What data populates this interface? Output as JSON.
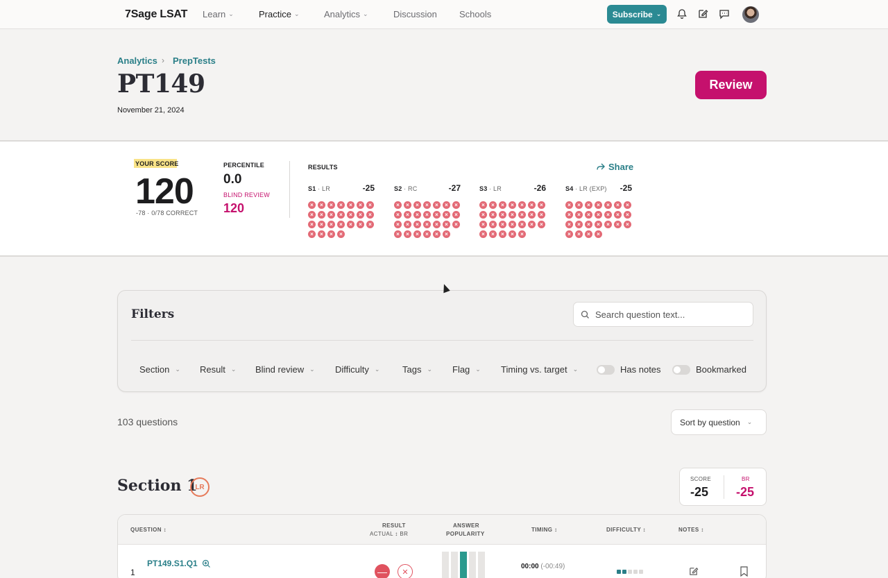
{
  "nav": {
    "brand": "7Sage LSAT",
    "items": [
      {
        "label": "Learn"
      },
      {
        "label": "Practice"
      },
      {
        "label": "Analytics"
      },
      {
        "label": "Discussion"
      },
      {
        "label": "Schools"
      }
    ],
    "subscribe_label": "Subscribe",
    "icons": [
      "bell-icon",
      "edit-icon",
      "chat-icon",
      "avatar"
    ]
  },
  "breadcrumb": {
    "items": [
      "Analytics",
      "PrepTests"
    ]
  },
  "page": {
    "title": "PT149",
    "date": "November 21, 2024",
    "review_label": "Review"
  },
  "score": {
    "your_score_label": "YOUR SCORE",
    "value": "120",
    "correct_text": "-78 · 0/78 CORRECT",
    "percentile_label": "PERCENTILE",
    "percentile_value": "0.0",
    "blind_review_label": "BLIND REVIEW",
    "blind_review_value": "120"
  },
  "results": {
    "label": "RESULTS",
    "share_label": "Share",
    "sections": [
      {
        "id": "S1",
        "type": "LR",
        "score": "-25",
        "questions": 25
      },
      {
        "id": "S2",
        "type": "RC",
        "score": "-27",
        "questions": 27
      },
      {
        "id": "S3",
        "type": "LR",
        "score": "-26",
        "questions": 26
      },
      {
        "id": "S4",
        "type": "LR (EXP)",
        "score": "-25",
        "questions": 25
      }
    ]
  },
  "filters": {
    "title": "Filters",
    "search_placeholder": "Search question text...",
    "chips": [
      "Section",
      "Result",
      "Blind review",
      "Difficulty",
      "Tags",
      "Flag",
      "Timing vs. target"
    ],
    "toggles": [
      "Has notes",
      "Bookmarked"
    ]
  },
  "list": {
    "count_text": "103 questions",
    "sort_label": "Sort by question"
  },
  "section1": {
    "title": "Section 1",
    "badge": "LR",
    "score_label": "SCORE",
    "score_value": "-25",
    "br_label": "BR",
    "br_value": "-25"
  },
  "table": {
    "headers": {
      "question": "QUESTION",
      "result": "RESULT",
      "actual": "ACTUAL",
      "br": "BR",
      "popularity_1": "ANSWER",
      "popularity_2": "POPULARITY",
      "timing": "TIMING",
      "difficulty": "DIFFICULTY",
      "notes": "NOTES"
    },
    "rows": [
      {
        "num": "1",
        "id": "PT149.S1.Q1",
        "time": "00:00",
        "delta": "(-00:49)",
        "difficulty_level": 2
      }
    ]
  },
  "colors": {
    "teal": "#2a7f88",
    "magenta": "#c5116d",
    "wrong": "#e36a76"
  }
}
